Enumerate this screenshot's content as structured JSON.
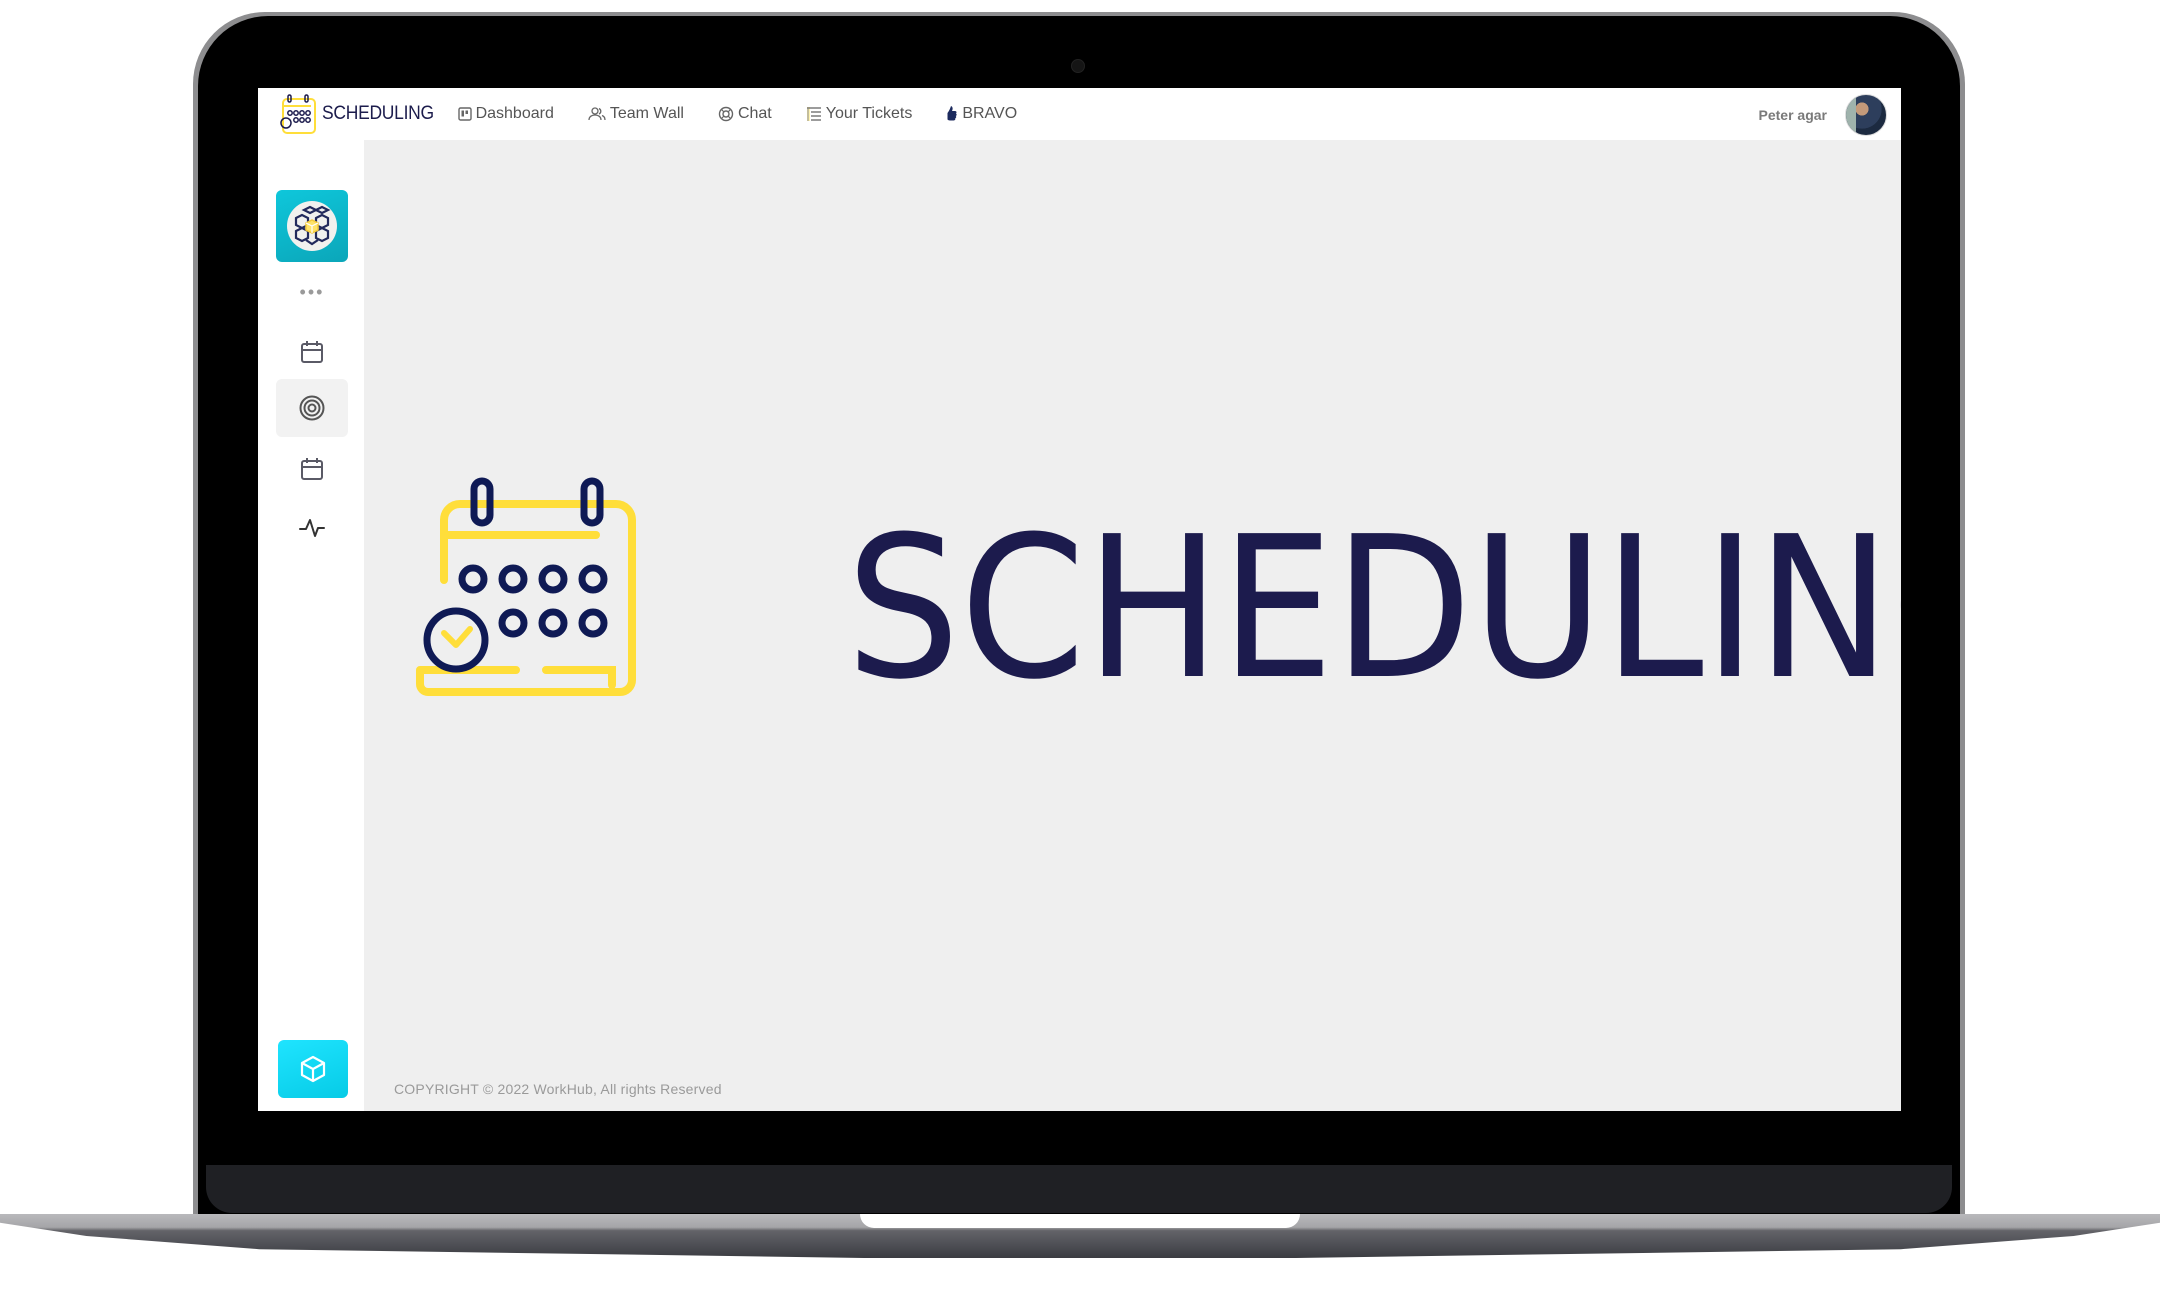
{
  "app": {
    "brand_name": "SCHEDULING",
    "colors": {
      "brand_navy": "#1c1b4d",
      "brand_yellow": "#ffde3a",
      "teal": "#0bb4c8",
      "cyan": "#15d6f0"
    }
  },
  "topbar": {
    "nav": [
      {
        "label": "Dashboard",
        "icon": "dashboard-icon"
      },
      {
        "label": "Team Wall",
        "icon": "team-icon"
      },
      {
        "label": "Chat",
        "icon": "chat-icon"
      },
      {
        "label": "Your Tickets",
        "icon": "tickets-icon"
      },
      {
        "label": "BRAVO",
        "icon": "bravo-thumb-icon"
      }
    ],
    "user_name": "Peter agar"
  },
  "sidebar": {
    "top_tile_icon": "cube-globe-logo-icon",
    "more_label": "•••",
    "items": [
      {
        "icon": "calendar-icon",
        "active": false
      },
      {
        "icon": "target-icon",
        "active": true
      },
      {
        "icon": "calendar-icon",
        "active": false
      },
      {
        "icon": "activity-pulse-icon",
        "active": false
      }
    ],
    "bottom_tile_icon": "cube-icon"
  },
  "main": {
    "hero_title": "SCHEDULING"
  },
  "footer": {
    "copyright": "COPYRIGHT © 2022 WorkHub, All rights Reserved"
  }
}
